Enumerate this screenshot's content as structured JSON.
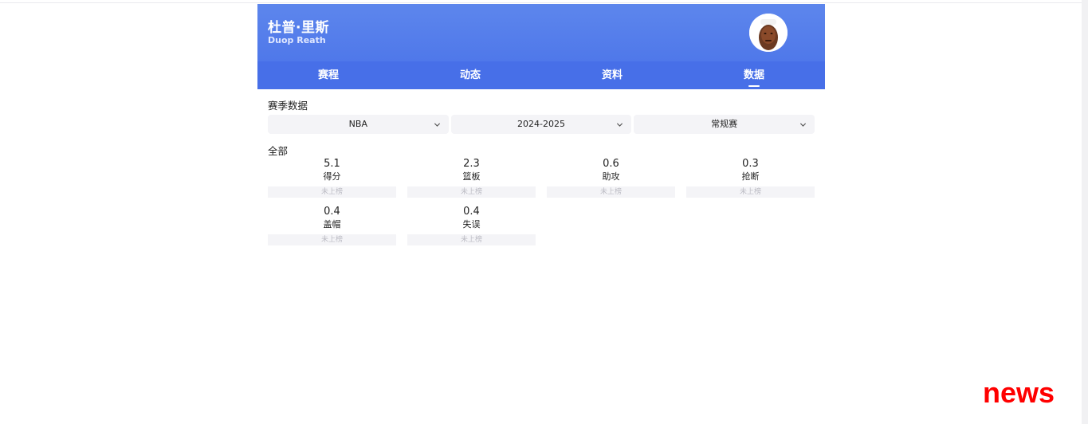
{
  "header": {
    "name_cn": "杜普·里斯",
    "name_en": "Duop Reath"
  },
  "tabs": [
    {
      "label": "赛程",
      "active": false
    },
    {
      "label": "动态",
      "active": false
    },
    {
      "label": "资料",
      "active": false
    },
    {
      "label": "数据",
      "active": true
    }
  ],
  "season_section": {
    "title": "赛季数据",
    "filters": [
      {
        "value": "NBA",
        "icon": "chevron-down-icon"
      },
      {
        "value": "2024-2025",
        "icon": "chevron-down-icon"
      },
      {
        "value": "常规赛",
        "icon": "chevron-down-icon"
      }
    ]
  },
  "stats_group": {
    "title": "全部",
    "items": [
      {
        "value": "5.1",
        "label": "得分",
        "rank": "未上榜"
      },
      {
        "value": "2.3",
        "label": "篮板",
        "rank": "未上榜"
      },
      {
        "value": "0.6",
        "label": "助攻",
        "rank": "未上榜"
      },
      {
        "value": "0.3",
        "label": "抢断",
        "rank": "未上榜"
      },
      {
        "value": "0.4",
        "label": "盖帽",
        "rank": "未上榜"
      },
      {
        "value": "0.4",
        "label": "失误",
        "rank": "未上榜"
      }
    ]
  },
  "watermark": {
    "text": "news",
    "color": "#ff0000"
  },
  "colors": {
    "header_gradient_top": "#5d86ec",
    "tab_bar": "#476fe8",
    "filter_bg": "#f4f4f7"
  }
}
